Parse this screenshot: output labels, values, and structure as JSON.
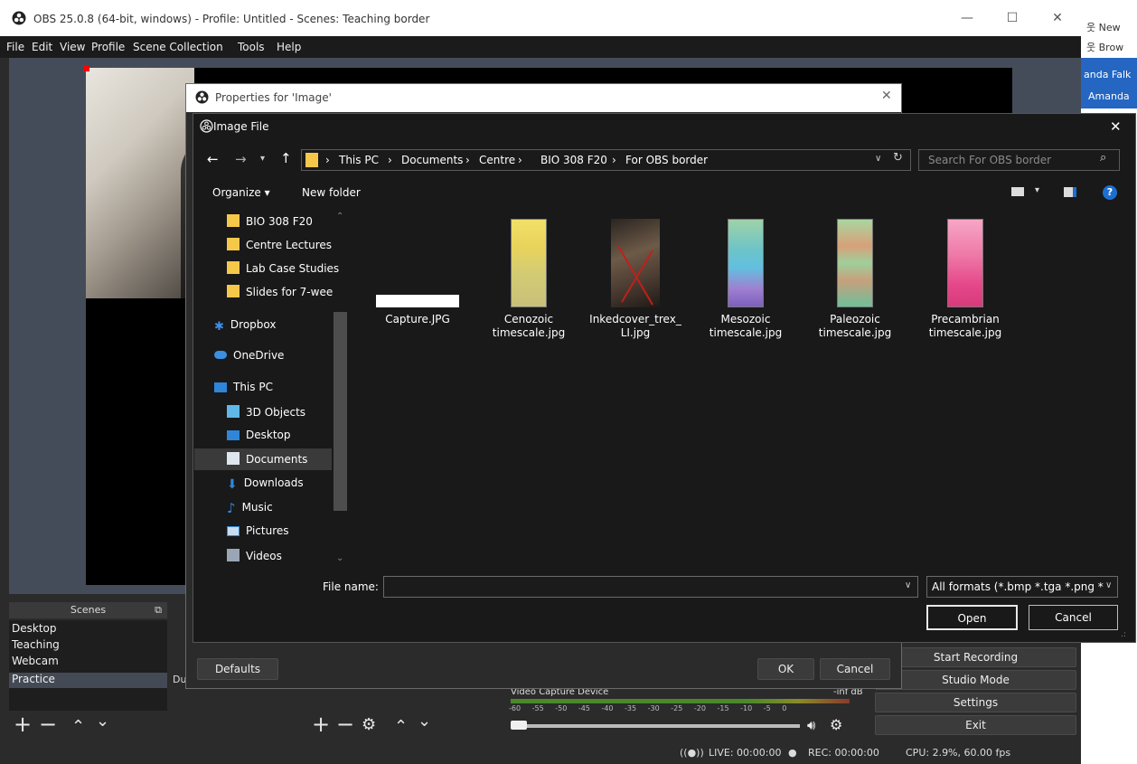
{
  "obs": {
    "title": "OBS 25.0.8 (64-bit, windows) - Profile: Untitled - Scenes: Teaching border",
    "menu": [
      "File",
      "Edit",
      "View",
      "Profile",
      "Scene Collection",
      "Tools",
      "Help"
    ],
    "scenes_header": "Scenes",
    "scenes": [
      "Desktop",
      "Teaching",
      "Webcam",
      "Practice"
    ],
    "sources_partial_label": "Du",
    "mixer": {
      "source": "Video Capture Device",
      "db": "-inf dB",
      "ticks": "-60 -55 -50 -45 -40 -35 -30 -25 -20 -15 -10 -5 0"
    },
    "controls": [
      "Start Recording",
      "Studio Mode",
      "Settings",
      "Exit"
    ],
    "status": {
      "live": "LIVE: 00:00:00",
      "rec": "REC: 00:00:00",
      "cpu": "CPU: 2.9%, 60.00 fps"
    }
  },
  "right_app": {
    "links": [
      "New",
      "Brow",
      "anda Falk",
      "Amanda"
    ]
  },
  "props_dialog": {
    "title": "Properties for 'Image'",
    "defaults": "Defaults",
    "ok": "OK",
    "cancel": "Cancel"
  },
  "file_dialog": {
    "title": "Image File",
    "breadcrumb": [
      "This PC",
      "Documents",
      "Centre",
      "BIO 308 F20",
      "For OBS border"
    ],
    "search_placeholder": "Search For OBS border",
    "organize": "Organize ▾",
    "new_folder": "New folder",
    "nav": [
      {
        "label": "BIO 308 F20",
        "icon": "folder-icon"
      },
      {
        "label": "Centre Lectures",
        "icon": "folder-icon"
      },
      {
        "label": "Lab Case Studies",
        "icon": "folder-icon"
      },
      {
        "label": "Slides for 7-week",
        "icon": "folder-icon"
      },
      {
        "label": "Dropbox",
        "icon": "dropbox-icon"
      },
      {
        "label": "OneDrive",
        "icon": "onedrive-icon"
      },
      {
        "label": "This PC",
        "icon": "computer-icon"
      },
      {
        "label": "3D Objects",
        "icon": "cube-icon"
      },
      {
        "label": "Desktop",
        "icon": "desktop-icon"
      },
      {
        "label": "Documents",
        "icon": "document-icon"
      },
      {
        "label": "Downloads",
        "icon": "download-icon"
      },
      {
        "label": "Music",
        "icon": "music-icon"
      },
      {
        "label": "Pictures",
        "icon": "pictures-icon"
      },
      {
        "label": "Videos",
        "icon": "videos-icon"
      }
    ],
    "files": [
      {
        "line1": "Capture.JPG",
        "line2": ""
      },
      {
        "line1": "Cenozoic",
        "line2": "timescale.jpg"
      },
      {
        "line1": "Inkedcover_trex_",
        "line2": "LI.jpg"
      },
      {
        "line1": "Mesozoic",
        "line2": "timescale.jpg"
      },
      {
        "line1": "Paleozoic",
        "line2": "timescale.jpg"
      },
      {
        "line1": "Precambrian",
        "line2": "timescale.jpg"
      }
    ],
    "file_name_label": "File name:",
    "file_name_value": "",
    "filter": "All formats (*.bmp *.tga *.png *",
    "open": "Open",
    "cancel": "Cancel"
  }
}
